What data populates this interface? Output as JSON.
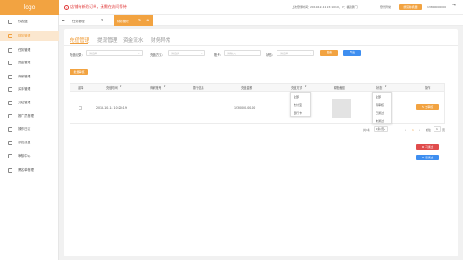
{
  "app": {
    "logo": "logo"
  },
  "sidebar": {
    "items": [
      {
        "label": "仪表盘"
      },
      {
        "label": "财务管理"
      },
      {
        "label": "任务管理"
      },
      {
        "label": "资金管理"
      },
      {
        "label": "商家管理"
      },
      {
        "label": "买手管理"
      },
      {
        "label": "分站管理"
      },
      {
        "label": "推广员管理"
      },
      {
        "label": "操作日志"
      },
      {
        "label": "系统设置"
      },
      {
        "label": "审核中心"
      },
      {
        "label": "黑名单管理"
      }
    ],
    "active_index": 1
  },
  "header": {
    "notice_icon": "!",
    "notice": "店铺有新的订单，无需在访问等待",
    "last_login": "上次登录时间：2019-12-11 13:10:10，IP：福建厦门",
    "status": "登录异常",
    "bind_button": "绑定新机器",
    "phone": "13800000000"
  },
  "tabs": [
    {
      "label": "任务管理"
    },
    {
      "label": "财务管理"
    }
  ],
  "panel_tabs": [
    {
      "label": "充值管理"
    },
    {
      "label": "提现管理"
    },
    {
      "label": "资金流水"
    },
    {
      "label": "财务异常"
    }
  ],
  "filters": {
    "type_label": "充值记录：",
    "type_placeholder": "请选择",
    "method_label": "充值方式：",
    "method_placeholder": "请选择",
    "account_label": "账号：",
    "account_placeholder": "请输入",
    "status_label": "状态：",
    "status_placeholder": "请选择",
    "search_button": "搜索",
    "export_button": "导出"
  },
  "batch_button": "批量审核",
  "table": {
    "headers": [
      "选择",
      "充值时间",
      "商家账号",
      "银行信息",
      "充值金额",
      "充值方式",
      "转账截图",
      "状态",
      "操作"
    ],
    "rows": [
      {
        "time": "2018-10-14 10:20:19",
        "amount": "1230000.00.00",
        "action": "去审核"
      }
    ],
    "method_options": [
      "全部",
      "支付宝",
      "银行卡"
    ],
    "status_options": [
      "全部",
      "待审核",
      "已通过",
      "未通过"
    ]
  },
  "pager": {
    "total": "共1条",
    "page_size": "5条/页",
    "current_page": "1",
    "goto_label": "前往",
    "goto_value": "1",
    "page_unit": "页"
  },
  "side_buttons": {
    "reject": "不通过",
    "approve": "已通过"
  },
  "colors": {
    "accent": "#f2a341",
    "danger": "#e04c4c",
    "primary": "#3e8ef0"
  }
}
